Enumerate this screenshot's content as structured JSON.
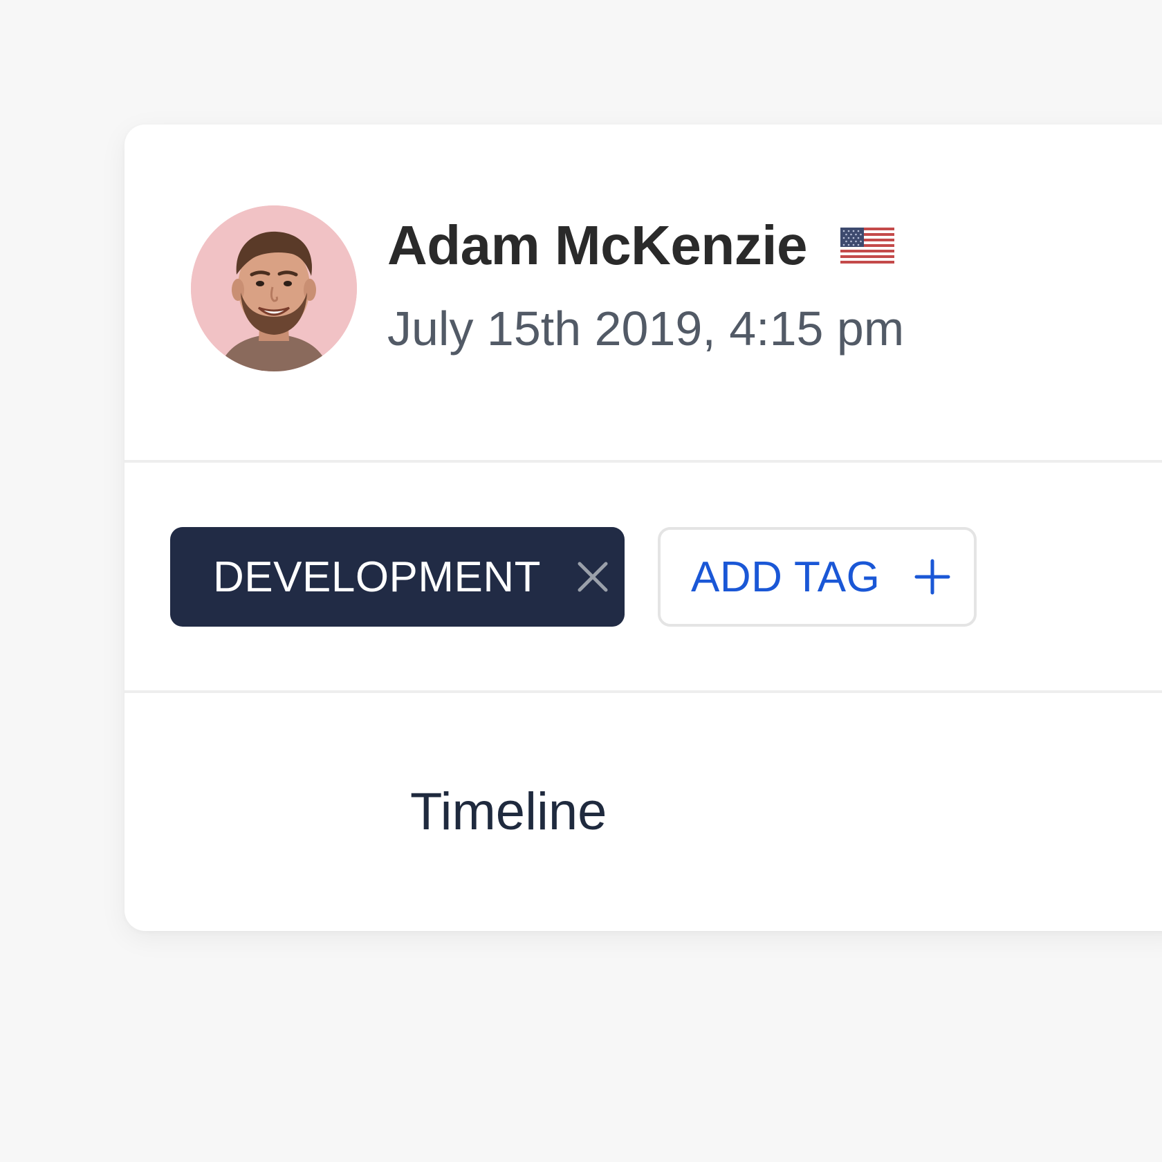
{
  "profile": {
    "name": "Adam McKenzie",
    "timestamp": "July 15th 2019, 4:15 pm",
    "avatar_icon": "user-avatar-photo",
    "country_flag_icon": "us-flag-icon"
  },
  "tags": {
    "items": [
      {
        "label": "DEVELOPMENT",
        "remove_icon": "close-icon"
      }
    ],
    "add_label": "ADD TAG",
    "add_icon": "plus-icon"
  },
  "section": {
    "title": "Timeline"
  },
  "colors": {
    "page_background": "#f7f7f7",
    "card_background": "#ffffff",
    "tag_chip_background": "#212b45",
    "accent_blue": "#1a57d6",
    "avatar_background": "#f1c2c5",
    "name_text": "#2a2a2a",
    "timestamp_text": "#525a66"
  }
}
